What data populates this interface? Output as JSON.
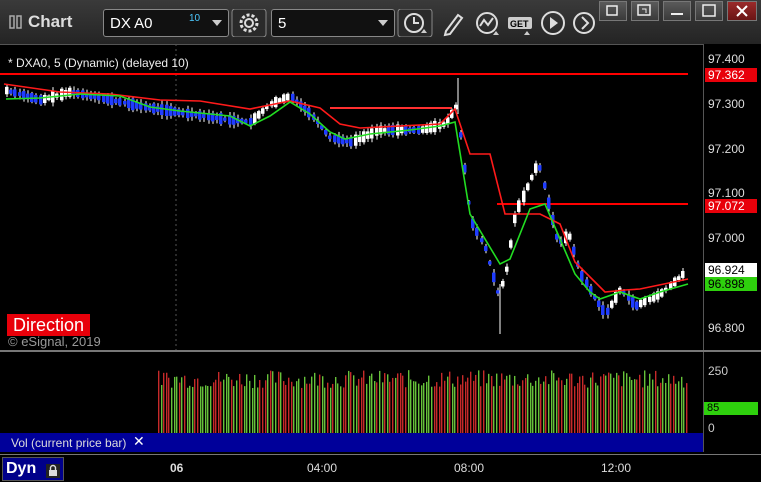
{
  "app": {
    "title": "Chart"
  },
  "toolbar": {
    "symbol": "DX A0",
    "symbol_badge": "10",
    "interval": "5"
  },
  "chart": {
    "info_line": "* DXA0, 5 (Dynamic) (delayed 10)",
    "direction_label": "Direction",
    "copyright": "© eSignal, 2019",
    "price_labels": [
      "97.400",
      "97.300",
      "97.200",
      "97.100",
      "97.000",
      "96.800"
    ],
    "price_tags": {
      "top_line": "97.362",
      "mid_line": "97.072",
      "last_price": "96.924",
      "ma_value": "96.898"
    },
    "colors": {
      "up_candle": "#ffffff",
      "down_candle": "#1f3cff",
      "ma_red": "#ff1a1a",
      "ma_green": "#22dd22",
      "level_line": "#ff0000"
    }
  },
  "volume": {
    "label": "Vol (current price bar)",
    "axis_labels": [
      "250",
      "0"
    ],
    "current_value": "85"
  },
  "time_axis": {
    "dyn_label": "Dyn",
    "labels": [
      "06",
      "04:00",
      "08:00",
      "12:00"
    ]
  }
}
